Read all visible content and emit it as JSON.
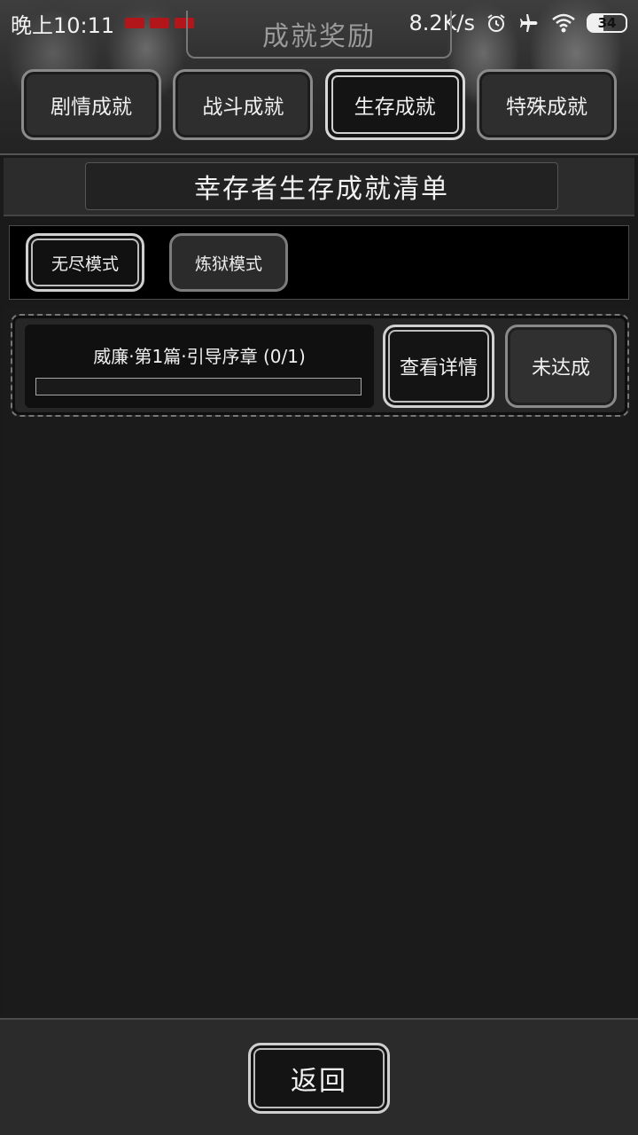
{
  "statusbar": {
    "time": "晚上10:11",
    "net_speed": "8.2K/s",
    "battery": "34"
  },
  "header": {
    "page_title": "成就奖励",
    "tabs": [
      {
        "label": "剧情成就",
        "active": false
      },
      {
        "label": "战斗成就",
        "active": false
      },
      {
        "label": "生存成就",
        "active": true
      },
      {
        "label": "特殊成就",
        "active": false
      }
    ]
  },
  "section": {
    "title": "幸存者生存成就清单"
  },
  "modes": [
    {
      "label": "无尽模式",
      "active": true
    },
    {
      "label": "炼狱模式",
      "active": false
    }
  ],
  "achievements": [
    {
      "title": "威廉·第1篇·引导序章 (0/1)",
      "progress": 0,
      "detail_label": "查看详情",
      "status_label": "未达成"
    }
  ],
  "footer": {
    "back_label": "返回"
  },
  "icons": {
    "alarm": "alarm-icon",
    "airplane": "airplane-mode-icon",
    "wifi": "wifi-icon",
    "battery": "battery-icon"
  }
}
